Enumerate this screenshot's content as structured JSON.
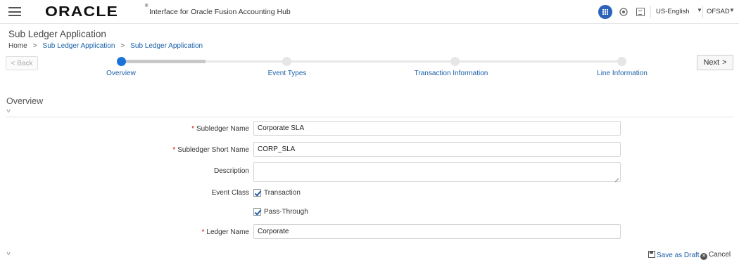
{
  "header": {
    "brand": "ORACLE",
    "app_title": "Interface for Oracle Fusion Accounting Hub",
    "language": "US-English",
    "user": "OFSAD"
  },
  "page": {
    "title": "Sub Ledger Application",
    "breadcrumb": [
      "Home",
      "Sub Ledger Application",
      "Sub Ledger Application"
    ]
  },
  "train": {
    "back_label": "Back",
    "next_label": "Next",
    "steps": [
      {
        "label": "Overview",
        "active": true
      },
      {
        "label": "Event Types",
        "active": false
      },
      {
        "label": "Transaction Information",
        "active": false
      },
      {
        "label": "Line Information",
        "active": false
      }
    ]
  },
  "section": {
    "title": "Overview"
  },
  "form": {
    "subledger_name": {
      "label": "Subledger Name",
      "value": "Corporate SLA",
      "required": true
    },
    "subledger_short_name": {
      "label": "Subledger Short Name",
      "value": "CORP_SLA",
      "required": true
    },
    "description": {
      "label": "Description",
      "value": ""
    },
    "event_class": {
      "label": "Event Class",
      "options": [
        {
          "label": "Transaction",
          "checked": true
        },
        {
          "label": "Pass-Through",
          "checked": true
        }
      ]
    },
    "ledger_name": {
      "label": "Ledger Name",
      "value": "Corporate",
      "required": true
    }
  },
  "footer": {
    "save_draft": "Save as Draft",
    "cancel": "Cancel"
  },
  "colors": {
    "link": "#1a5fa8",
    "active_step": "#1a73d9",
    "required": "#cc0000",
    "apps_button": "#2a63b8"
  }
}
